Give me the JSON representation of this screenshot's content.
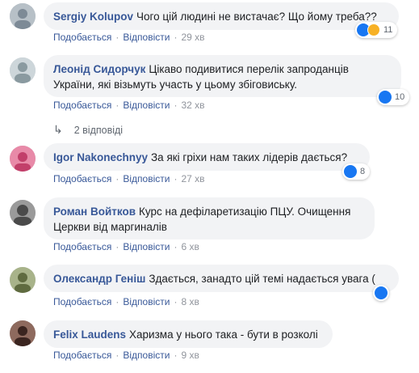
{
  "actions": {
    "like": "Подобається",
    "reply": "Відповісти"
  },
  "comments": [
    {
      "author": "Sergiy Kolupov",
      "text": "Чого цій людині не вистачає? Що йому треба??",
      "time": "29 хв",
      "reactions": "11",
      "avatar_color": "#7d8a96"
    },
    {
      "author": "Леонід Сидорчук",
      "text": "Цікаво подивитися перелік запроданців України, які візьмуть участь у цьому збіговиську.",
      "time": "32 хв",
      "reactions": "10",
      "avatar_color": "#8a9aa0"
    },
    {
      "author": "Igor Nakonechnyy",
      "text": "За які гріхи нам таких лідерів дається?",
      "time": "27 хв",
      "reactions": "8",
      "avatar_color": "#d85a83"
    },
    {
      "author": "Роман Войтков",
      "text": "Курс на дефіларетизацію ПЦУ. Очищення Церкви від маргиналів",
      "time": "6 хв",
      "reactions": "",
      "avatar_color": "#4a4a4a"
    },
    {
      "author": "Олександр Геніш",
      "text": "Здається, занадто цій темі надається увага (",
      "time": "8 хв",
      "reactions": "",
      "avatar_color": "#7b8a5a"
    },
    {
      "author": "Felix Laudens",
      "text": "Харизма у нього така - бути в розколі",
      "time": "9 хв",
      "reactions": "",
      "avatar_color": "#5a3a32"
    }
  ],
  "replies_label": "2 відповіді"
}
